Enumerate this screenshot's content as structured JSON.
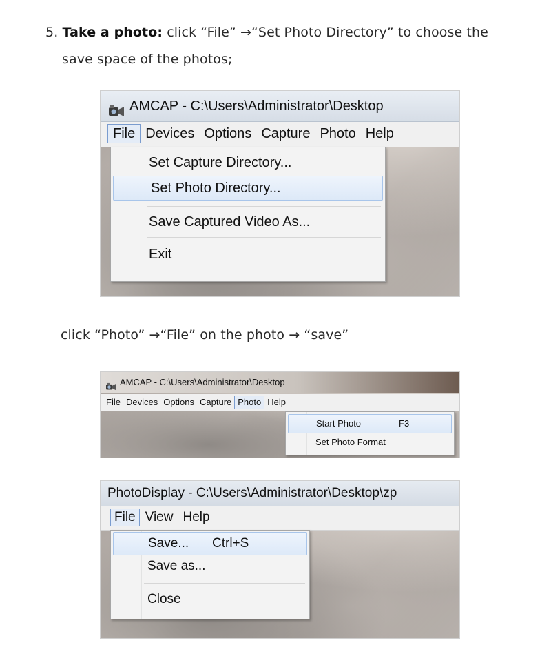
{
  "step": {
    "number": "5.",
    "bold": "Take a photo:",
    "line1_rest": " click “File” →“Set Photo Directory” to choose the",
    "line2": "save space of the photos;"
  },
  "caption2": "click “Photo” →“File” on the photo → “save”",
  "shot1": {
    "title": "AMCAP - C:\\Users\\Administrator\\Desktop",
    "menu": [
      "File",
      "Devices",
      "Options",
      "Capture",
      "Photo",
      "Help"
    ],
    "items": [
      "Set Capture Directory...",
      "Set Photo Directory...",
      "Save Captured Video As...",
      "Exit"
    ]
  },
  "shot2": {
    "title": "AMCAP - C:\\Users\\Administrator\\Desktop",
    "menu": [
      "File",
      "Devices",
      "Options",
      "Capture",
      "Photo",
      "Help"
    ],
    "items": [
      {
        "label": "Start Photo",
        "accel": "F3"
      },
      {
        "label": "Set Photo Format",
        "accel": ""
      }
    ]
  },
  "shot3": {
    "title": "PhotoDisplay - C:\\Users\\Administrator\\Desktop\\zp",
    "menu": [
      "File",
      "View",
      "Help"
    ],
    "items": [
      {
        "label": "Save...",
        "accel": "Ctrl+S"
      },
      {
        "label": "Save as...",
        "accel": ""
      },
      {
        "label": "Close",
        "accel": ""
      }
    ]
  },
  "icon": "camera-icon"
}
